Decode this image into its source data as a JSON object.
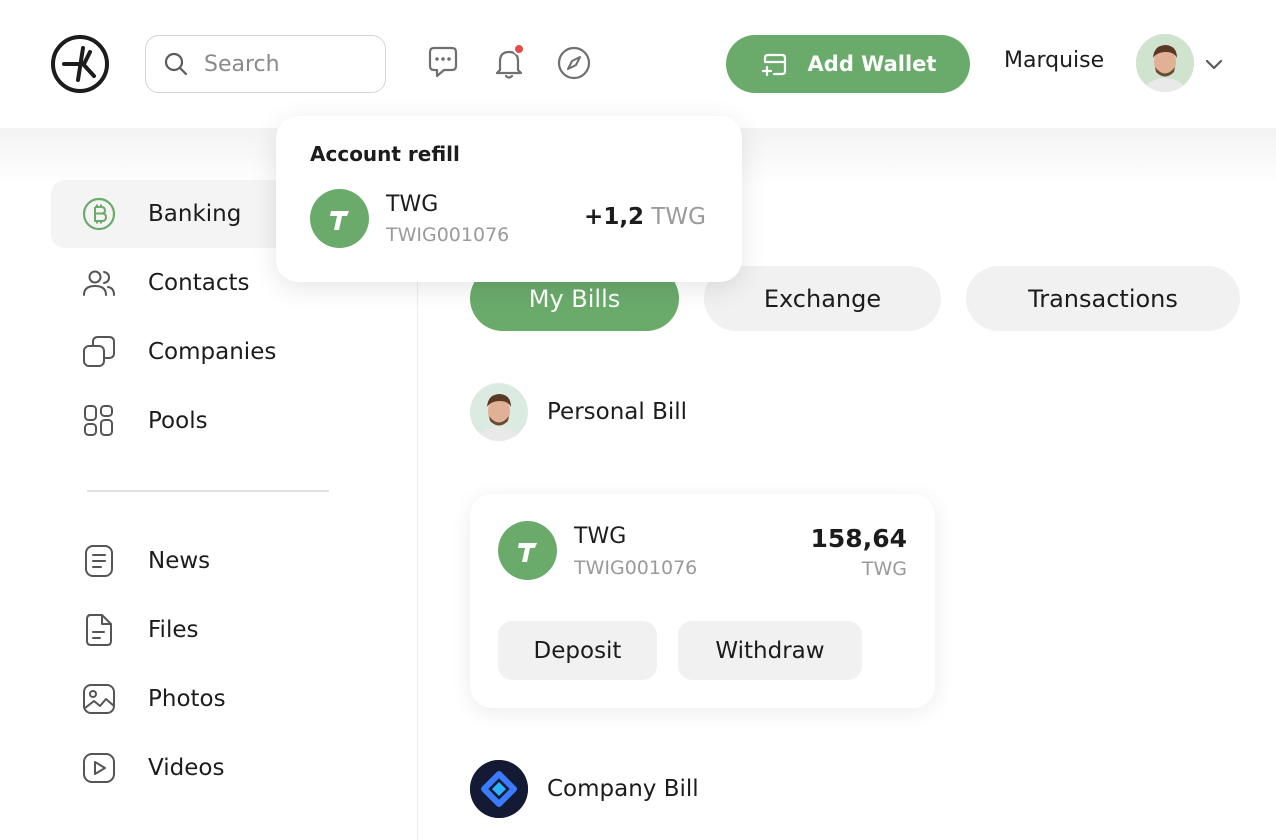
{
  "header": {
    "search_placeholder": "Search",
    "add_wallet_label": "Add Wallet",
    "user_name": "Marquise",
    "accent_color": "#6aab6b",
    "notification_dot_color": "#e84a4a"
  },
  "sidebar": {
    "items": [
      {
        "label": "Banking",
        "icon": "bitcoin-circle-icon",
        "active": true
      },
      {
        "label": "Contacts",
        "icon": "users-icon"
      },
      {
        "label": "Companies",
        "icon": "companies-icon"
      },
      {
        "label": "Pools",
        "icon": "grid-icon"
      },
      {
        "label": "News",
        "icon": "news-icon"
      },
      {
        "label": "Files",
        "icon": "file-icon"
      },
      {
        "label": "Photos",
        "icon": "image-icon"
      },
      {
        "label": "Videos",
        "icon": "video-icon"
      }
    ]
  },
  "tabs": [
    {
      "label": "My Bills",
      "active": true
    },
    {
      "label": "Exchange"
    },
    {
      "label": "Transactions"
    }
  ],
  "personal_bill": {
    "title": "Personal Bill",
    "card": {
      "name": "TWG",
      "account": "TWIG001076",
      "amount": "158,64",
      "currency": "TWG",
      "deposit_label": "Deposit",
      "withdraw_label": "Withdraw"
    }
  },
  "company_bill": {
    "title": "Company Bill"
  },
  "popover": {
    "title": "Account refill",
    "name": "TWG",
    "account": "TWIG001076",
    "amount": "+1,2",
    "currency": "TWG"
  }
}
